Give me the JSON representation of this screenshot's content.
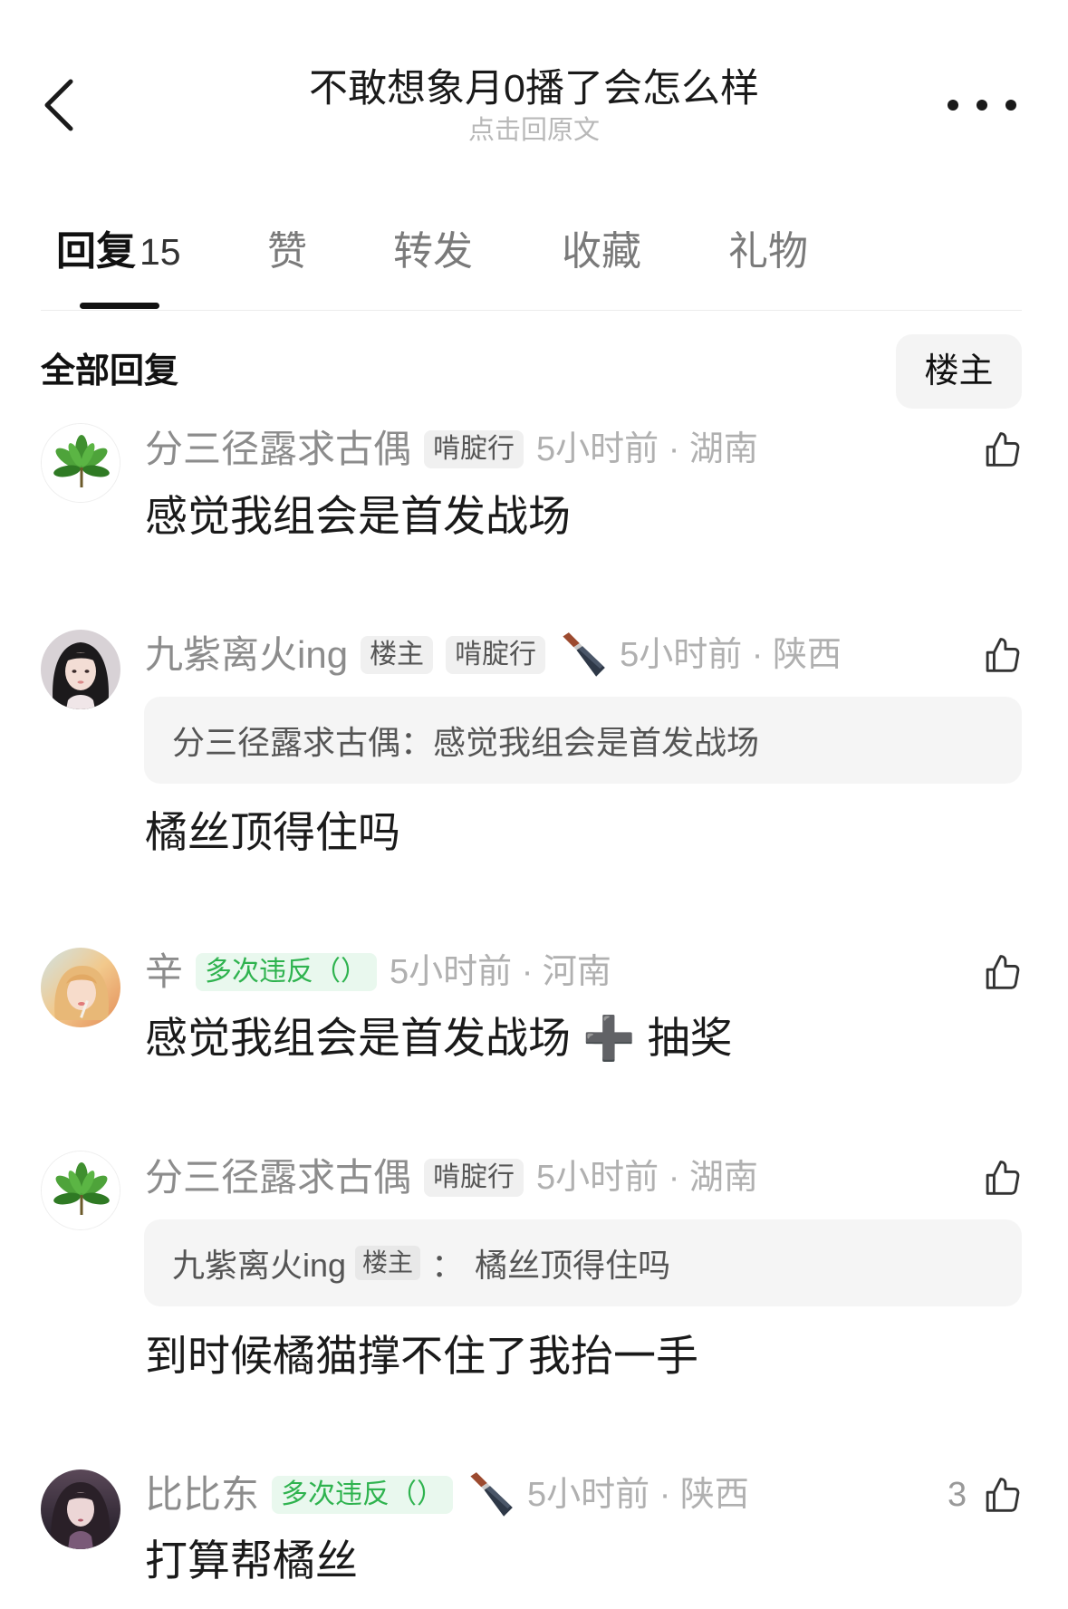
{
  "header": {
    "title": "不敢想象月0播了会怎么样",
    "subtitle": "点击回原文",
    "back_icon": "chevron-left-icon",
    "more_icon": "more-dots-icon"
  },
  "tabs": [
    {
      "label": "回复",
      "count": "15",
      "active": true
    },
    {
      "label": "赞"
    },
    {
      "label": "转发"
    },
    {
      "label": "收藏"
    },
    {
      "label": "礼物"
    }
  ],
  "filter": {
    "heading": "全部回复",
    "op_button": "楼主"
  },
  "colors": {
    "text": "#1a1a1a",
    "name": "#8c8c8c",
    "time": "#b0b0b0",
    "badge_bg": "#f0f0f0",
    "badge_green_bg": "#e9f8ee",
    "badge_green_text": "#2fb34f",
    "quote_bg": "#f5f5f5"
  },
  "comments": [
    {
      "avatar": "leaf-avatar",
      "name": "分三径露求古偶",
      "badges": [
        {
          "text": "啃腚行",
          "type": "gray"
        }
      ],
      "time": "5小时前 · 湖南",
      "text": "感觉我组会是首发战场"
    },
    {
      "avatar": "girl-avatar",
      "name": "九紫离火ing",
      "badges": [
        {
          "text": "楼主",
          "type": "gray"
        },
        {
          "text": "啃腚行",
          "type": "gray"
        }
      ],
      "icon": "knife-icon",
      "time": "5小时前 · 陕西",
      "quote": {
        "author": "分三径露求古偶",
        "sep": "：",
        "text": "感觉我组会是首发战场"
      },
      "text": "橘丝顶得住吗"
    },
    {
      "avatar": "warm-photo-avatar",
      "name": "辛",
      "badges": [
        {
          "text": "多次违反（）",
          "type": "green"
        }
      ],
      "time": "5小时前 · 河南",
      "text": "感觉我组会是首发战场 ➕ 抽奖"
    },
    {
      "avatar": "leaf-avatar",
      "name": "分三径露求古偶",
      "badges": [
        {
          "text": "啃腚行",
          "type": "gray"
        }
      ],
      "time": "5小时前 · 湖南",
      "quote": {
        "author": "九紫离火ing",
        "author_badge": "楼主",
        "sep": "：",
        "text": "橘丝顶得住吗"
      },
      "text": "到时候橘猫撑不住了我抬一手"
    },
    {
      "avatar": "dark-portrait-avatar",
      "name": "比比东",
      "badges": [
        {
          "text": "多次违反（）",
          "type": "green"
        }
      ],
      "icon": "knife-icon",
      "time": "5小时前 · 陕西",
      "likes": "3",
      "text": "打算帮橘丝"
    }
  ]
}
